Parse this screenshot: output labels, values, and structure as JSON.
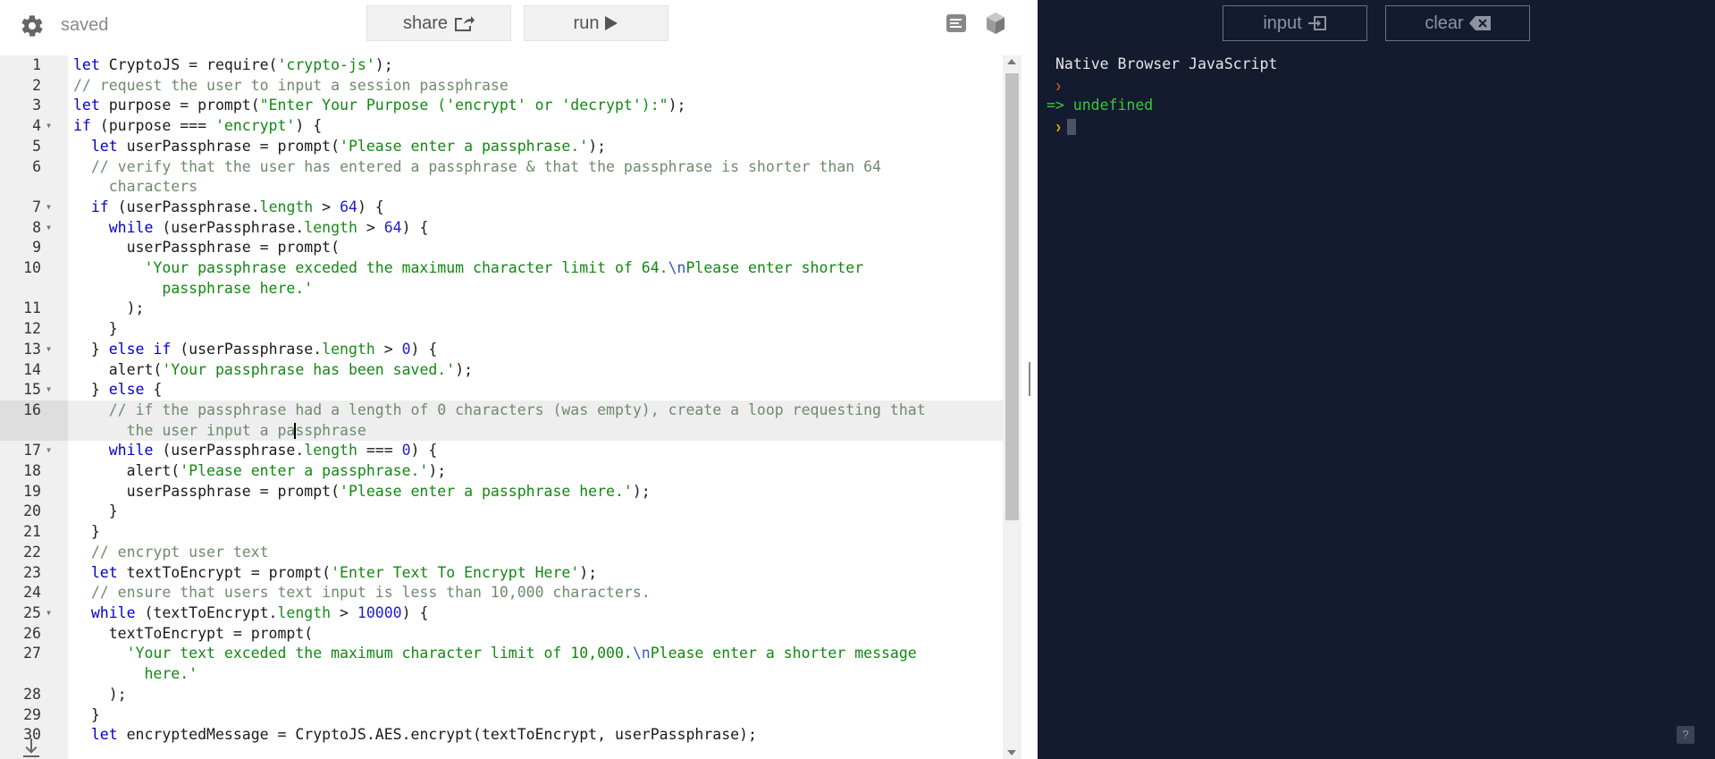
{
  "topbar": {
    "status": "saved",
    "share_label": "share",
    "run_label": "run"
  },
  "editor": {
    "lines": [
      {
        "n": "1",
        "html": "<span class=\"kw\">let</span> CryptoJS = require(<span class=\"str\">'crypto-js'</span>);"
      },
      {
        "n": "2",
        "html": "<span class=\"com\">// request the user to input a session passphrase</span>"
      },
      {
        "n": "3",
        "html": "<span class=\"kw\">let</span> purpose = prompt(<span class=\"str\">\"Enter Your Purpose ('encrypt' or 'decrypt'):\"</span>);"
      },
      {
        "n": "4",
        "fold": true,
        "html": "<span class=\"kw\">if</span> (purpose === <span class=\"str\">'encrypt'</span>) {"
      },
      {
        "n": "5",
        "html": "  <span class=\"kw\">let</span> userPassphrase = prompt(<span class=\"str\">'Please enter a passphrase.'</span>);"
      },
      {
        "n": "6",
        "html": "  <span class=\"com\">// verify that the user has entered a passphrase &amp; that the passphrase is shorter than 64</span>"
      },
      {
        "n": "",
        "html": "    <span class=\"com\">characters</span>"
      },
      {
        "n": "7",
        "fold": true,
        "html": "  <span class=\"kw\">if</span> (userPassphrase.<span class=\"prop\">length</span> &gt; <span class=\"num-l\">64</span>) {"
      },
      {
        "n": "8",
        "fold": true,
        "html": "    <span class=\"kw\">while</span> (userPassphrase.<span class=\"prop\">length</span> &gt; <span class=\"num-l\">64</span>) {"
      },
      {
        "n": "9",
        "html": "      userPassphrase = prompt("
      },
      {
        "n": "10",
        "html": "        <span class=\"str\">'Your passphrase exceded the maximum character limit of 64.</span><span class=\"esc\">\\n</span><span class=\"str\">Please enter shorter</span>"
      },
      {
        "n": "",
        "html": "          <span class=\"str\">passphrase here.'</span>"
      },
      {
        "n": "11",
        "html": "      );"
      },
      {
        "n": "12",
        "html": "    }"
      },
      {
        "n": "13",
        "fold": true,
        "html": "  } <span class=\"kw\">else if</span> (userPassphrase.<span class=\"prop\">length</span> &gt; <span class=\"num-l\">0</span>) {"
      },
      {
        "n": "14",
        "html": "    alert(<span class=\"str\">'Your passphrase has been saved.'</span>);"
      },
      {
        "n": "15",
        "fold": true,
        "html": "  } <span class=\"kw\">else</span> {"
      },
      {
        "n": "16",
        "active": true,
        "html": "    <span class=\"com\">// if the passphrase had a length of 0 characters (was empty), create a loop requesting that</span>"
      },
      {
        "n": "",
        "active": true,
        "html": "      <span class=\"com\">the user input a pa<span class=\"cursor\"></span>ssphrase</span>"
      },
      {
        "n": "17",
        "fold": true,
        "html": "    <span class=\"kw\">while</span> (userPassphrase.<span class=\"prop\">length</span> === <span class=\"num-l\">0</span>) {"
      },
      {
        "n": "18",
        "html": "      alert(<span class=\"str\">'Please enter a passphrase.'</span>);"
      },
      {
        "n": "19",
        "html": "      userPassphrase = prompt(<span class=\"str\">'Please enter a passphrase here.'</span>);"
      },
      {
        "n": "20",
        "html": "    }"
      },
      {
        "n": "21",
        "html": "  }"
      },
      {
        "n": "22",
        "html": "  <span class=\"com\">// encrypt user text</span>"
      },
      {
        "n": "23",
        "html": "  <span class=\"kw\">let</span> textToEncrypt = prompt(<span class=\"str\">'Enter Text To Encrypt Here'</span>);"
      },
      {
        "n": "24",
        "html": "  <span class=\"com\">// ensure that users text input is less than 10,000 characters.</span>"
      },
      {
        "n": "25",
        "fold": true,
        "html": "  <span class=\"kw\">while</span> (textToEncrypt.<span class=\"prop\">length</span> &gt; <span class=\"num-l\">10000</span>) {"
      },
      {
        "n": "26",
        "html": "    textToEncrypt = prompt("
      },
      {
        "n": "27",
        "html": "      <span class=\"str\">'Your text exceded the maximum character limit of 10,000.</span><span class=\"esc\">\\n</span><span class=\"str\">Please enter a shorter message</span>"
      },
      {
        "n": "",
        "html": "        <span class=\"str\">here.'</span>"
      },
      {
        "n": "28",
        "html": "    );"
      },
      {
        "n": "29",
        "html": "  }"
      },
      {
        "n": "30",
        "html": "  <span class=\"kw\">let</span> encryptedMessage = CryptoJS.AES.encrypt(textToEncrypt, userPassphrase);"
      }
    ]
  },
  "console": {
    "input_label": "input",
    "clear_label": "clear",
    "header": "Native Browser JavaScript",
    "result": "=> undefined",
    "help_label": "?"
  }
}
